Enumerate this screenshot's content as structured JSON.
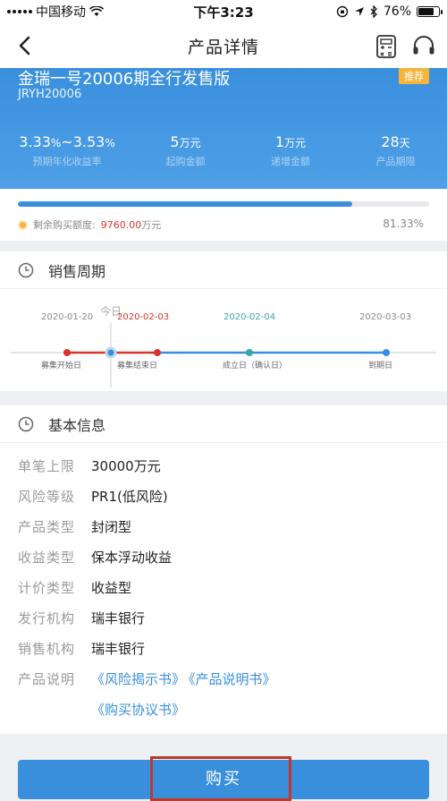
{
  "status_bar": {
    "carrier": "中国移动",
    "time": "下午3:23",
    "battery": "76%",
    "battery_level": 0.76
  },
  "nav": {
    "title": "产品详情"
  },
  "product": {
    "name": "金瑞一号20006期全行发售版",
    "code": "JRYH20006",
    "badge": "推荐",
    "metrics": [
      {
        "value": "3.33",
        "unit1": "%",
        "sep": "~",
        "value2": "3.53",
        "unit2": "%",
        "label": "预期年化收益率"
      },
      {
        "value": "5",
        "unit": "万元",
        "label": "起购金额"
      },
      {
        "value": "1",
        "unit": "万元",
        "label": "递增金额"
      },
      {
        "value": "28",
        "unit": "天",
        "label": "产品期限"
      }
    ]
  },
  "progress": {
    "percent": 0.8133,
    "remain_label": "剩余购买额度:",
    "remain_amount": "9760.00",
    "remain_unit": "万元",
    "percent_text": "81.33%"
  },
  "sales_period": {
    "title": "销售周期",
    "today_label": "今日",
    "points": [
      {
        "date": "2020-01-20",
        "label": "募集开始日"
      },
      {
        "date": "2020-02-03",
        "label": "募集结束日"
      },
      {
        "date": "2020-02-04",
        "label": "成立日（确认日）"
      },
      {
        "date": "2020-03-03",
        "label": "到期日"
      }
    ]
  },
  "basic_info": {
    "title": "基本信息",
    "rows": [
      {
        "k": "单笔上限",
        "v": "30000万元"
      },
      {
        "k": "风险等级",
        "v": "PR1(低风险)"
      },
      {
        "k": "产品类型",
        "v": "封闭型"
      },
      {
        "k": "收益类型",
        "v": "保本浮动收益"
      },
      {
        "k": "计价类型",
        "v": "收益型"
      },
      {
        "k": "发行机构",
        "v": "瑞丰银行"
      },
      {
        "k": "销售机构",
        "v": "瑞丰银行"
      }
    ],
    "doc_label": "产品说明",
    "docs": [
      "《风险揭示书》",
      "《产品说明书》",
      "《购买协议书》"
    ]
  },
  "buy_button": {
    "label": "购买"
  },
  "colors": {
    "primary": "#3a8fdd",
    "accent_red": "#d9342b",
    "badge": "#f5b53d",
    "established": "#3aa6a8"
  }
}
